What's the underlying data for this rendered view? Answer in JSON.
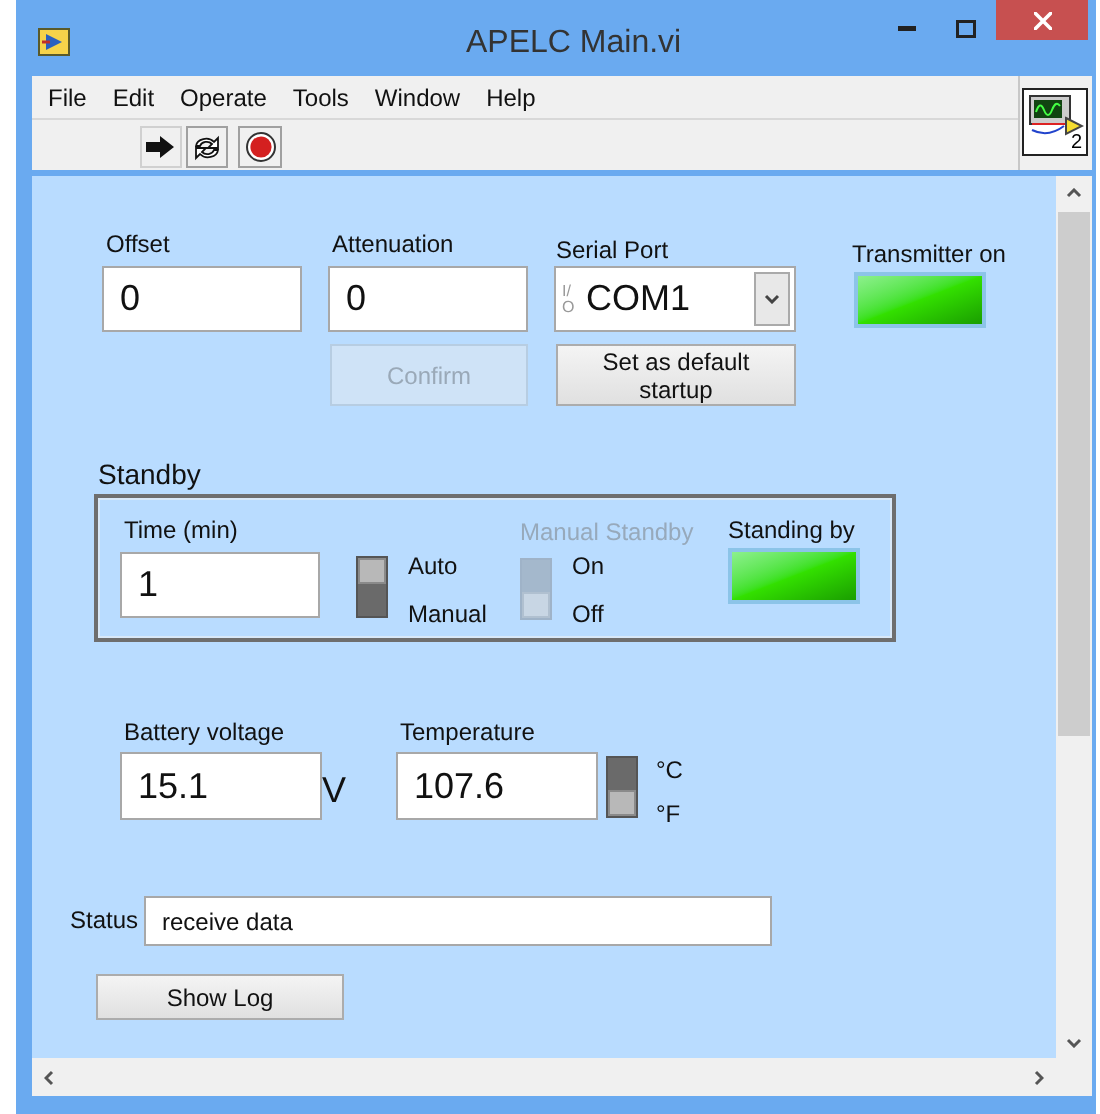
{
  "window": {
    "title": "APELC Main.vi"
  },
  "menu": [
    "File",
    "Edit",
    "Operate",
    "Tools",
    "Window",
    "Help"
  ],
  "connector_pane": {
    "label": "2"
  },
  "panel": {
    "offset": {
      "label": "Offset",
      "value": "0"
    },
    "attenuation": {
      "label": "Attenuation",
      "value": "0"
    },
    "serial_port": {
      "label": "Serial Port",
      "prefix": "I/O",
      "value": "COM1"
    },
    "transmitter": {
      "label": "Transmitter on",
      "on": true
    },
    "confirm_button": {
      "label": "Confirm",
      "disabled": true
    },
    "default_button": {
      "label": "Set as default startup",
      "disabled": false
    },
    "standby": {
      "title": "Standby",
      "time": {
        "label": "Time (min)",
        "value": "1"
      },
      "mode_switch": {
        "disabled": false,
        "up": true,
        "options": [
          "Auto",
          "Manual"
        ]
      },
      "manual_standby": {
        "label": "Manual Standby",
        "disabled": true,
        "up": false,
        "options": [
          "On",
          "Off"
        ]
      },
      "standing_by": {
        "label": "Standing by",
        "on": true
      }
    },
    "battery": {
      "label": "Battery voltage",
      "value": "15.1",
      "unit": "V"
    },
    "temperature": {
      "label": "Temperature",
      "value": "107.6",
      "switch": {
        "disabled": false,
        "up": false,
        "options": [
          "°C",
          "°F"
        ]
      }
    },
    "status": {
      "label": "Status",
      "value": "receive data"
    },
    "show_log_button": {
      "label": "Show Log",
      "disabled": false
    }
  }
}
